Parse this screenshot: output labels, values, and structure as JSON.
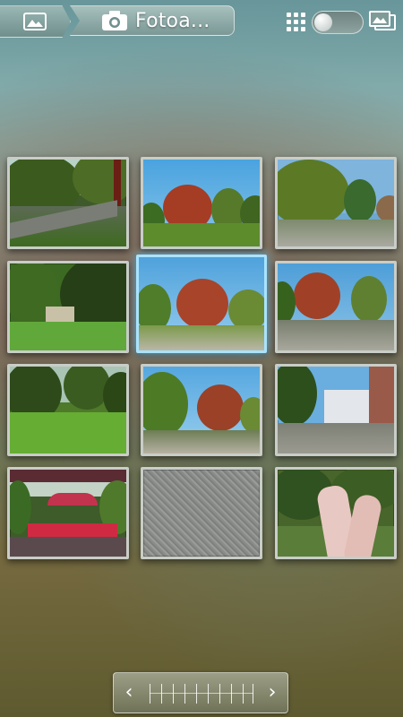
{
  "header": {
    "album_title": "Fotoa...",
    "home_icon": "gallery-icon",
    "album_icon": "camera-icon",
    "grid_view_icon": "grid-icon",
    "view_toggle": "toggle",
    "slideshow_icon": "slideshow-icon"
  },
  "grid": {
    "columns": 3,
    "rows": 4,
    "selected_index": 4,
    "photos": [
      {
        "name": "photo-1",
        "scene": "park-path"
      },
      {
        "name": "photo-2",
        "scene": "red-tree"
      },
      {
        "name": "photo-3",
        "scene": "plaza-trees"
      },
      {
        "name": "photo-4",
        "scene": "green-lawn"
      },
      {
        "name": "photo-5",
        "scene": "red-tree-selected"
      },
      {
        "name": "photo-6",
        "scene": "red-tree-fountain"
      },
      {
        "name": "photo-7",
        "scene": "meadow"
      },
      {
        "name": "photo-8",
        "scene": "red-tree-plaza"
      },
      {
        "name": "photo-9",
        "scene": "building-street"
      },
      {
        "name": "photo-10",
        "scene": "red-pavilion"
      },
      {
        "name": "photo-11",
        "scene": "gravel-ground"
      },
      {
        "name": "photo-12",
        "scene": "hands-bracelet"
      }
    ]
  },
  "footer": {
    "scroll_left_icon": "chevron-left-icon",
    "scroll_right_icon": "chevron-right-icon"
  },
  "colors": {
    "selected_border": "#a9e3ff",
    "tile_border": "#c9cdc7"
  }
}
